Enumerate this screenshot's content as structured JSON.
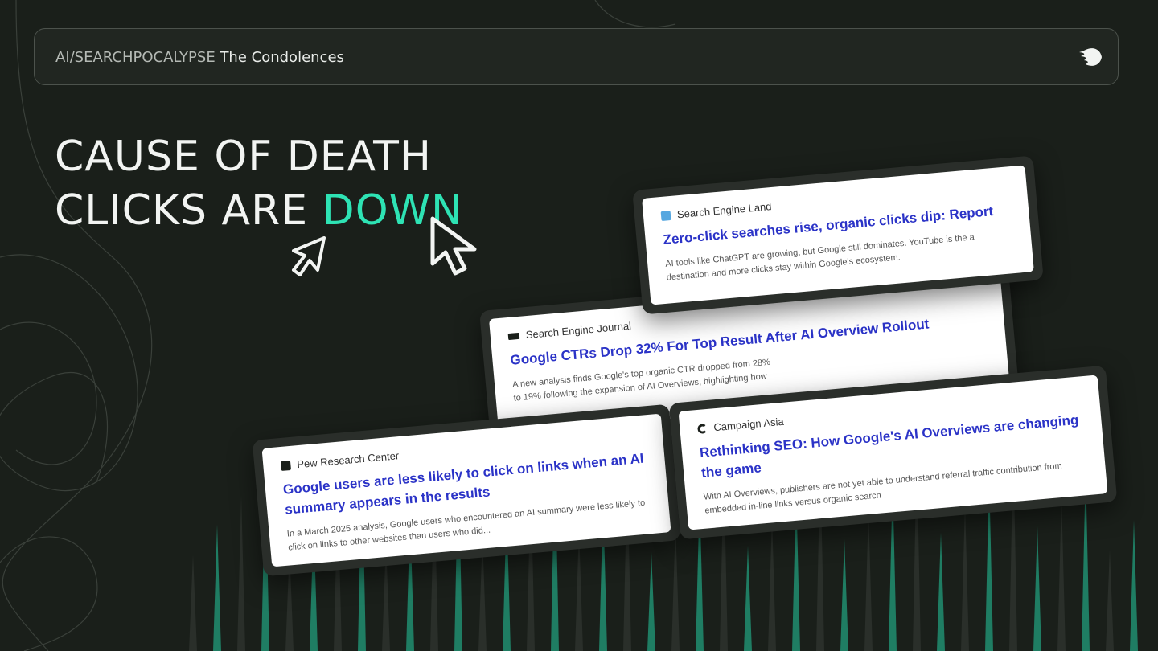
{
  "header": {
    "section": "AI/SEARCHPOCALYPSE",
    "subtitle": "The Condolences",
    "logo_icon": "rocket-icon"
  },
  "headline": {
    "line1": "CAUSE OF DEATH",
    "line2_prefix": "CLICKS ARE",
    "line2_accent": "DOWN",
    "accent_color": "#2ee3b4"
  },
  "cards": {
    "sel": {
      "source": "Search Engine Land",
      "title": "Zero-click searches rise, organic clicks dip: Report",
      "desc": "AI tools like ChatGPT are growing, but Google still dominates. YouTube is the a destination and more clicks stay within Google's ecosystem."
    },
    "sej": {
      "source": "Search Engine Journal",
      "title": "Google CTRs Drop 32% For Top Result After AI Overview Rollout",
      "desc": "A new analysis finds Google's top organic CTR dropped from 28% to 19% following the expansion of AI Overviews, highlighting how"
    },
    "pew": {
      "source": "Pew Research Center",
      "title": "Google users are less likely to click on links when an AI summary appears in the results",
      "desc": "In a March 2025 analysis, Google users who encountered an AI summary were less likely to click on links to other websites than users who did..."
    },
    "ca": {
      "source": "Campaign Asia",
      "title": "Rethinking SEO: How Google's AI Overviews are changing the game",
      "desc": "With AI Overviews, publishers are not yet able to understand referral traffic contribution from embedded in-line links versus organic search ."
    }
  },
  "colors": {
    "background": "#1a1f1a",
    "accent": "#2ee3b4",
    "link_title": "#2b33c7"
  }
}
